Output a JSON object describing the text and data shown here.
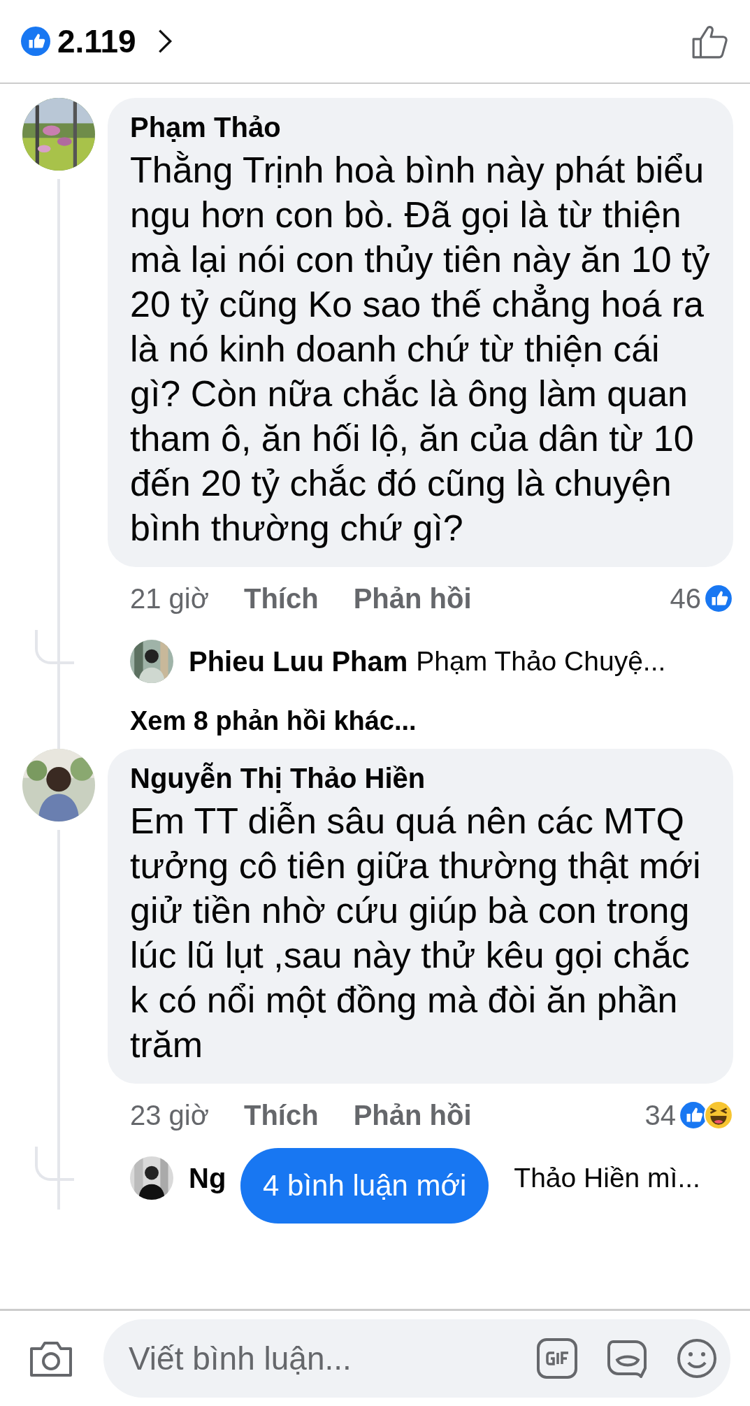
{
  "header": {
    "reaction_count": "2.119"
  },
  "comments": [
    {
      "author": "Phạm Thảo",
      "text": "Thằng Trịnh hoà bình này phát biểu ngu hơn con bò. Đã gọi là từ thiện mà lại nói con thủy tiên này ăn 10 tỷ 20 tỷ cũng Ko sao thế chẳng hoá ra là nó kinh doanh chứ từ thiện cái gì? Còn nữa chắc là ông làm quan tham ô, ăn hối lộ, ăn của dân từ 10 đến 20 tỷ chắc đó cũng là chuyện bình thường chứ gì?",
      "time": "21 giờ",
      "like_label": "Thích",
      "reply_label": "Phản hồi",
      "reaction_count": "46",
      "reactions": [
        {
          "kind": "like"
        }
      ],
      "replies": [
        {
          "kind": "plain",
          "author": "Phieu Luu Pham",
          "text": "Phạm Thảo  Chuyệ..."
        }
      ],
      "more_replies": "Xem 8 phản hồi khác..."
    },
    {
      "author": "Nguyễn Thị Thảo Hiền",
      "text": "Em TT diễn sâu quá nên các MTQ tưởng cô tiên giữa thường thật mới giử tiền nhờ cứu giúp bà con trong lúc lũ lụt ,sau này thử kêu gọi chắc k có nổi một đồng mà đòi ăn phần trăm",
      "time": "23 giờ",
      "like_label": "Thích",
      "reply_label": "Phản hồi",
      "reaction_count": "34",
      "reactions": [
        {
          "kind": "like"
        },
        {
          "kind": "haha"
        }
      ],
      "replies": [
        {
          "kind": "covered",
          "author": "Ng",
          "text": "Thảo Hiền mì..."
        }
      ]
    }
  ],
  "new_comments_pill": "4 bình luận mới",
  "composer": {
    "placeholder": "Viết bình luận..."
  }
}
